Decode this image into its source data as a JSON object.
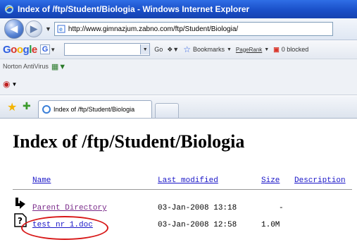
{
  "window": {
    "title": "Index of /ftp/Student/Biologia - Windows Internet Explorer"
  },
  "address": {
    "url": "http://www.gimnazjum.zabno.com/ftp/Student/Biologia/"
  },
  "toolbar": {
    "google": "Google",
    "go": "Go",
    "bookmarks": "Bookmarks",
    "pagerank": "PageRank",
    "blocked": "0 blocked"
  },
  "norton": {
    "label": "Norton AntiVirus"
  },
  "tab": {
    "title": "Index of /ftp/Student/Biologia"
  },
  "page": {
    "heading": "Index of /ftp/Student/Biologia",
    "columns": {
      "name": "Name",
      "modified": "Last modified",
      "size": "Size",
      "description": "Description"
    },
    "rows": [
      {
        "name": "Parent Directory",
        "modified": "03-Jan-2008 13:18",
        "size": "-"
      },
      {
        "name": "test nr 1.doc",
        "modified": "03-Jan-2008 12:58",
        "size": "1.0M"
      }
    ]
  },
  "colors": {
    "titlebar": "#1a4fc8",
    "link": "#1a16c8",
    "visited": "#7a2a8a",
    "highlight": "#d81818"
  }
}
